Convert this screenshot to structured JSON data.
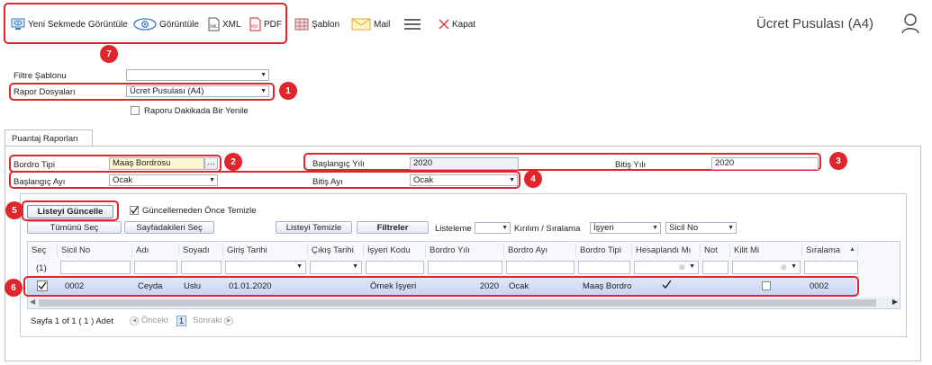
{
  "toolbar": {
    "open_new_tab": "Yeni Sekmede Görüntüle",
    "view": "Görüntüle",
    "xml": "XML",
    "pdf": "PDF",
    "template": "Şablon",
    "mail": "Mail",
    "close": "Kapat"
  },
  "page_title": "Ücret Pusulası (A4)",
  "filters": {
    "filter_template_label": "Filtre Şablonu",
    "filter_template_value": "",
    "report_file_label": "Rapor Dosyaları",
    "report_file_value": "Ücret Pusulası (A4)",
    "refresh_label": "Raporu Dakikada Bir Yenile"
  },
  "tab": "Puantaj Raporları",
  "form": {
    "bordro_type_label": "Bordro Tipi",
    "bordro_type_value": "Maaş Bordrosu",
    "start_year_label": "Başlangıç Yılı",
    "start_year_value": "2020",
    "end_year_label": "Bitiş Yılı",
    "end_year_value": "2020",
    "start_month_label": "Başlangıç Ayı",
    "start_month_value": "Ocak",
    "end_month_label": "Bitiş Ayı",
    "end_month_value": "Ocak"
  },
  "actions": {
    "update_list": "Listeyi Güncelle",
    "clear_before_update": "Güncellemeden Önce Temizle",
    "select_all": "Tümünü Seç",
    "select_page": "Sayfadakileri Seç",
    "clear_list": "Listeyi Temizle",
    "filters": "Filtreler",
    "listing_label": "Listeleme",
    "breakdown_label": "Kırılım / Sıralama",
    "breakdown_value_1": "İşyeri",
    "breakdown_value_2": "Sicil No"
  },
  "badges": [
    "1",
    "2",
    "3",
    "4",
    "5",
    "6",
    "7"
  ],
  "grid": {
    "columns": [
      "Seç",
      "Sicil No",
      "Adı",
      "Soyadı",
      "Giriş Tarihi",
      "Çıkış Tarihi",
      "İşyeri Kodu",
      "Bordro Yılı",
      "Bordro Ayı",
      "Bordro Tipi",
      "Hesaplandı Mı",
      "Not",
      "Kilit Mi",
      "Sıralama"
    ],
    "filter_row_label": "(1)",
    "row": {
      "sicil_no": "0002",
      "adi": "Ceyda",
      "soyadi": "Uslu",
      "giris_tarihi": "01.01.2020",
      "isyeri_kodu": "Örnek İşyeri",
      "bordro_yili": "2020",
      "bordro_ayi": "Ocak",
      "bordro_tipi": "Maaş Bordro",
      "siralama": "0002"
    }
  },
  "pager": {
    "info": "Sayfa 1 of 1 ( 1 ) Adet",
    "prev": "Önceki",
    "page": "1",
    "next": "Sonraki"
  }
}
